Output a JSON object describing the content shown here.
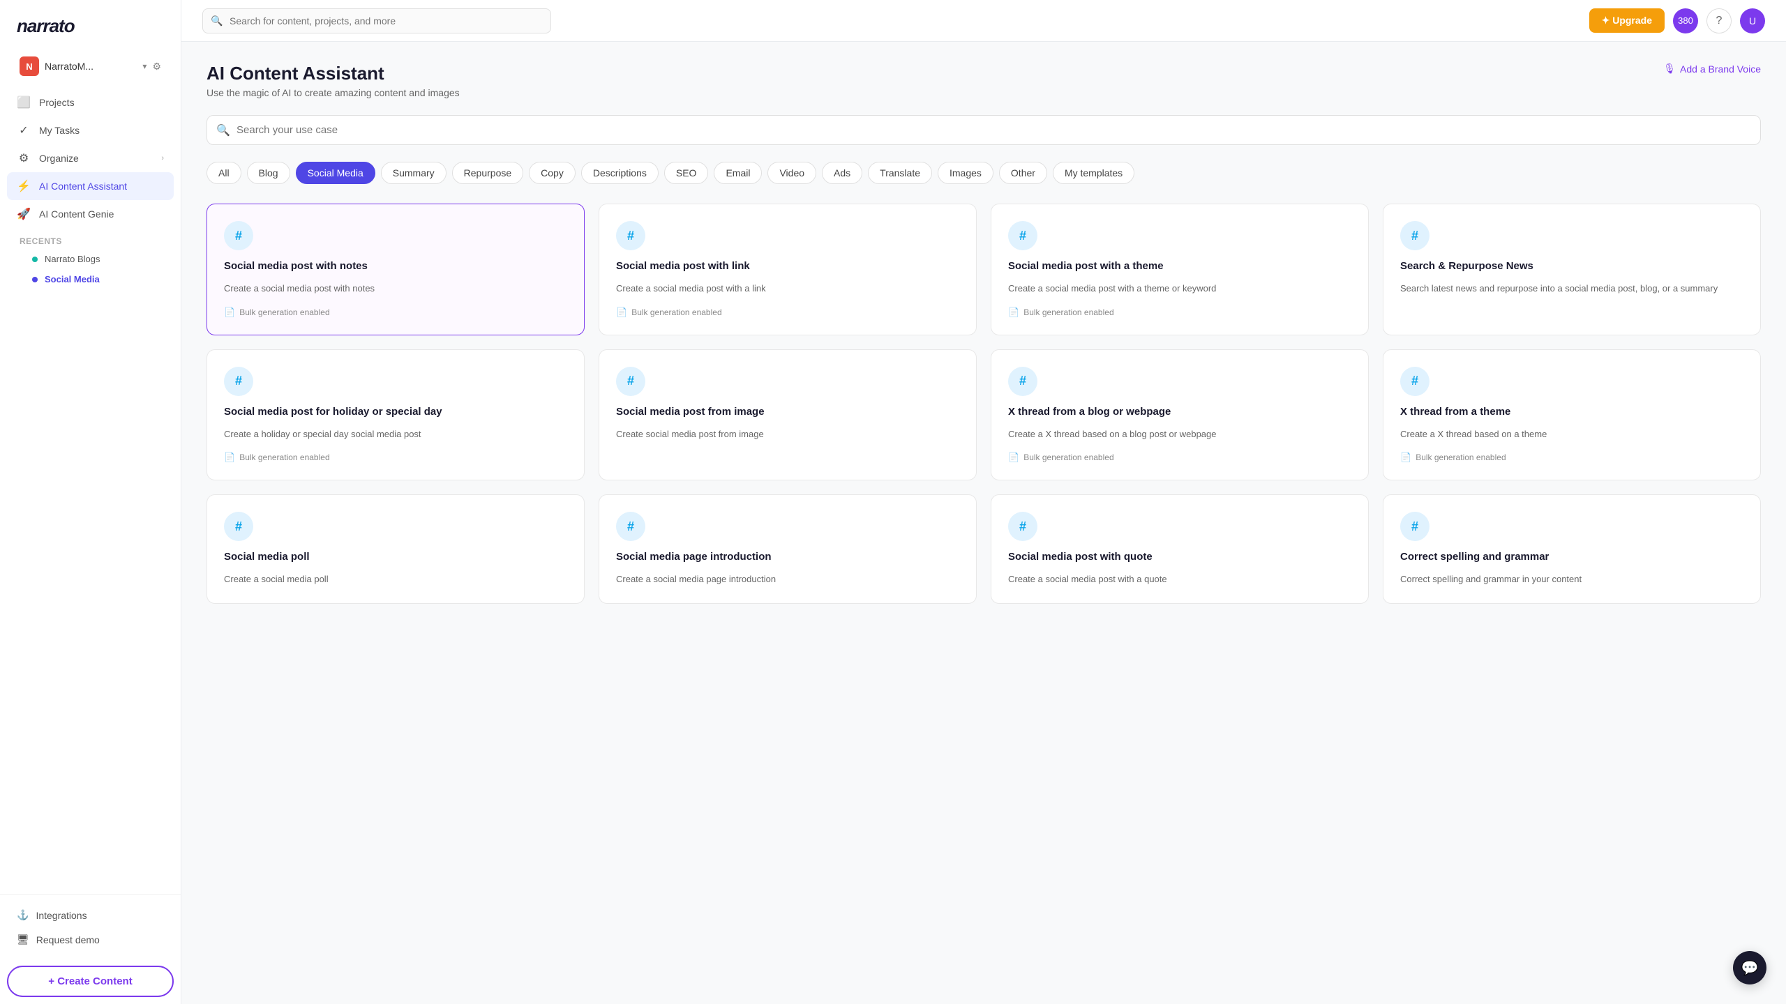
{
  "sidebar": {
    "logo": "narrato",
    "account": {
      "initials": "N",
      "name": "NarratoM...",
      "color": "#e74c3c"
    },
    "nav": [
      {
        "id": "projects",
        "label": "Projects",
        "icon": "⬜"
      },
      {
        "id": "my-tasks",
        "label": "My Tasks",
        "icon": "✓"
      },
      {
        "id": "organize",
        "label": "Organize",
        "icon": "⚙",
        "hasArrow": true
      },
      {
        "id": "ai-content-assistant",
        "label": "AI Content Assistant",
        "icon": "⚡",
        "active": true
      },
      {
        "id": "ai-content-genie",
        "label": "AI Content Genie",
        "icon": "🚀"
      }
    ],
    "recents_label": "Recents",
    "recents": [
      {
        "id": "narrato-blogs",
        "label": "Narrato Blogs",
        "color": "teal"
      },
      {
        "id": "social-media",
        "label": "Social Media",
        "color": "blue",
        "active": true
      }
    ],
    "bottom": [
      {
        "id": "integrations",
        "label": "Integrations",
        "icon": "⚓"
      },
      {
        "id": "request-demo",
        "label": "Request demo",
        "icon": "🖥"
      }
    ],
    "create_btn": "+ Create Content"
  },
  "header": {
    "search_placeholder": "Search for content, projects, and more",
    "upgrade_label": "✦ Upgrade",
    "notifications_count": "380"
  },
  "page": {
    "title": "AI Content Assistant",
    "subtitle": "Use the magic of AI to create amazing content and images",
    "brand_voice_label": "Add a Brand Voice"
  },
  "filter_search_placeholder": "Search your use case",
  "filters": [
    {
      "id": "all",
      "label": "All"
    },
    {
      "id": "blog",
      "label": "Blog"
    },
    {
      "id": "social-media",
      "label": "Social Media",
      "active": true
    },
    {
      "id": "summary",
      "label": "Summary"
    },
    {
      "id": "repurpose",
      "label": "Repurpose"
    },
    {
      "id": "copy",
      "label": "Copy"
    },
    {
      "id": "descriptions",
      "label": "Descriptions"
    },
    {
      "id": "seo",
      "label": "SEO"
    },
    {
      "id": "email",
      "label": "Email"
    },
    {
      "id": "video",
      "label": "Video"
    },
    {
      "id": "ads",
      "label": "Ads"
    },
    {
      "id": "translate",
      "label": "Translate"
    },
    {
      "id": "images",
      "label": "Images"
    },
    {
      "id": "other",
      "label": "Other"
    },
    {
      "id": "my-templates",
      "label": "My templates"
    }
  ],
  "cards": [
    {
      "id": "card-1",
      "title": "Social media post with notes",
      "desc": "Create a social media post with notes",
      "bulk": "Bulk generation enabled",
      "selected": true
    },
    {
      "id": "card-2",
      "title": "Social media post with link",
      "desc": "Create a social media post with a link",
      "bulk": "Bulk generation enabled",
      "selected": false
    },
    {
      "id": "card-3",
      "title": "Social media post with a theme",
      "desc": "Create a social media post with a theme or keyword",
      "bulk": "Bulk generation enabled",
      "selected": false
    },
    {
      "id": "card-4",
      "title": "Search & Repurpose News",
      "desc": "Search latest news and repurpose into a social media post, blog, or a summary",
      "bulk": null,
      "selected": false
    },
    {
      "id": "card-5",
      "title": "Social media post for holiday or special day",
      "desc": "Create a holiday or special day social media post",
      "bulk": "Bulk generation enabled",
      "selected": false
    },
    {
      "id": "card-6",
      "title": "Social media post from image",
      "desc": "Create social media post from image",
      "bulk": null,
      "selected": false
    },
    {
      "id": "card-7",
      "title": "X thread from a blog or webpage",
      "desc": "Create a X thread based on a blog post or webpage",
      "bulk": "Bulk generation enabled",
      "selected": false
    },
    {
      "id": "card-8",
      "title": "X thread from a theme",
      "desc": "Create a X thread based on a theme",
      "bulk": "Bulk generation enabled",
      "selected": false
    },
    {
      "id": "card-9",
      "title": "Social media poll",
      "desc": "Create a social media poll",
      "bulk": null,
      "selected": false
    },
    {
      "id": "card-10",
      "title": "Social media page introduction",
      "desc": "Create a social media page introduction",
      "bulk": null,
      "selected": false
    },
    {
      "id": "card-11",
      "title": "Social media post with quote",
      "desc": "Create a social media post with a quote",
      "bulk": null,
      "selected": false
    },
    {
      "id": "card-12",
      "title": "Correct spelling and grammar",
      "desc": "Correct spelling and grammar in your content",
      "bulk": null,
      "selected": false
    }
  ],
  "chat_icon": "💬"
}
